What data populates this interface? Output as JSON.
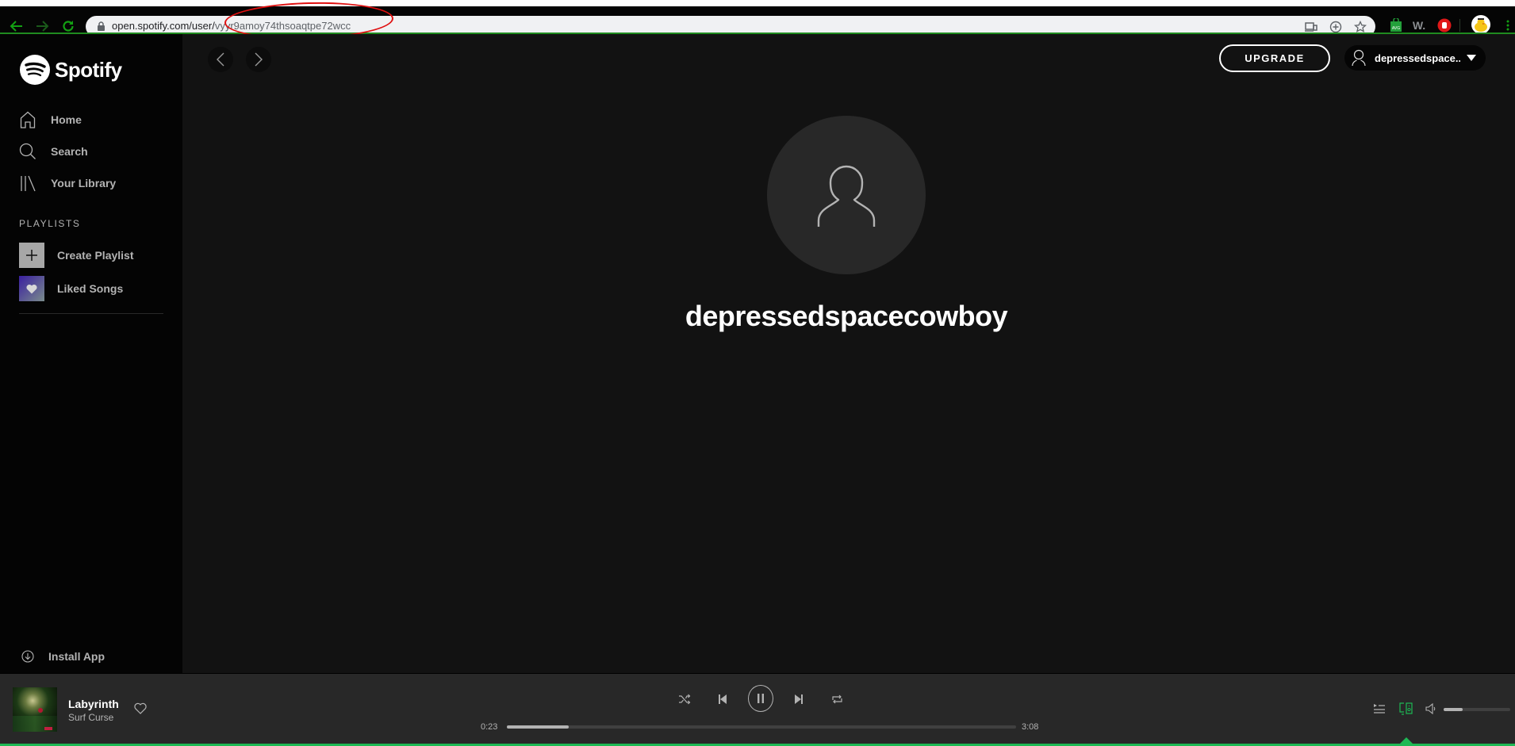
{
  "browser": {
    "url_host": "open.spotify.com/user/",
    "url_path": "vyyr9amoy74thsoaqtpe72wcc",
    "extensions": [
      "avg-icon",
      "w-extension-icon",
      "adblock-hand-icon",
      "profile-duck-avatar"
    ]
  },
  "sidebar": {
    "brand": "Spotify",
    "nav": [
      {
        "label": "Home",
        "icon": "home-icon"
      },
      {
        "label": "Search",
        "icon": "search-icon"
      },
      {
        "label": "Your Library",
        "icon": "library-icon"
      }
    ],
    "playlists_heading": "PLAYLISTS",
    "playlist_actions": [
      {
        "label": "Create Playlist",
        "icon": "plus-icon"
      },
      {
        "label": "Liked Songs",
        "icon": "heart-icon"
      }
    ],
    "install_label": "Install App"
  },
  "header": {
    "upgrade_label": "UPGRADE",
    "user_display": "depressedspace...",
    "colors": {
      "accent": "#1db954"
    }
  },
  "profile": {
    "name": "depressedspacecowboy"
  },
  "player": {
    "track_title": "Labyrinth",
    "track_artist": "Surf Curse",
    "elapsed": "0:23",
    "duration": "3:08",
    "progress_fraction": 0.122,
    "volume_fraction": 0.29,
    "state": "playing"
  }
}
